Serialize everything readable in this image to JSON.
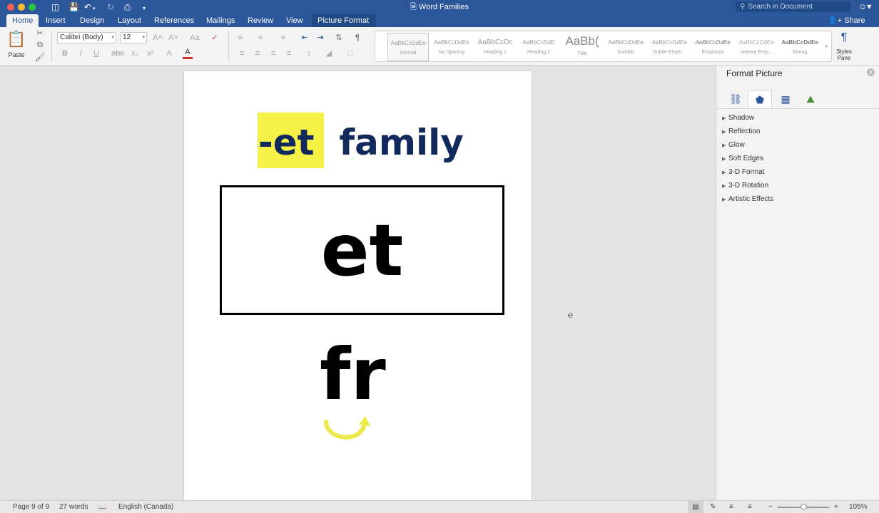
{
  "window": {
    "title": "Word Families",
    "search_placeholder": "Search in Document",
    "share_label": "Share"
  },
  "tabs": [
    {
      "label": "Home"
    },
    {
      "label": "Insert"
    },
    {
      "label": "Design"
    },
    {
      "label": "Layout"
    },
    {
      "label": "References"
    },
    {
      "label": "Mailings"
    },
    {
      "label": "Review"
    },
    {
      "label": "View"
    },
    {
      "label": "Picture Format"
    }
  ],
  "ribbon": {
    "paste_label": "Paste",
    "font_name": "Calibri (Body)",
    "font_size": "12",
    "styles_pane_label_1": "Styles",
    "styles_pane_label_2": "Pane",
    "styles": [
      {
        "sample": "AaBbCcDdEe",
        "name": "Normal"
      },
      {
        "sample": "AaBbCcDdEe",
        "name": "No Spacing"
      },
      {
        "sample": "AaBbCcDc",
        "name": "Heading 1"
      },
      {
        "sample": "AaBbCcDdE",
        "name": "Heading 2"
      },
      {
        "sample": "AaBb(",
        "name": "Title"
      },
      {
        "sample": "AaBbCcDdEe",
        "name": "Subtitle"
      },
      {
        "sample": "AaBbCcDdEe",
        "name": "Subtle Emph..."
      },
      {
        "sample": "AaBbCcDdEe",
        "name": "Emphasis"
      },
      {
        "sample": "AaBbCcDdEe",
        "name": "Intense Emp..."
      },
      {
        "sample": "AaBbCcDdEe",
        "name": "Strong"
      }
    ]
  },
  "document": {
    "heading": "-et  family",
    "box_word": "et",
    "onset": "fr"
  },
  "pane": {
    "title": "Format Picture",
    "sections": [
      {
        "label": "Shadow"
      },
      {
        "label": "Reflection"
      },
      {
        "label": "Glow"
      },
      {
        "label": "Soft Edges"
      },
      {
        "label": "3-D Format"
      },
      {
        "label": "3-D Rotation"
      },
      {
        "label": "Artistic Effects"
      }
    ]
  },
  "status": {
    "page": "Page 9 of 9",
    "words": "27 words",
    "language": "English (Canada)",
    "zoom": "105%"
  },
  "colors": {
    "accent": "#2b579a",
    "highlight": "#f6f146",
    "heading_text": "#12295c"
  }
}
